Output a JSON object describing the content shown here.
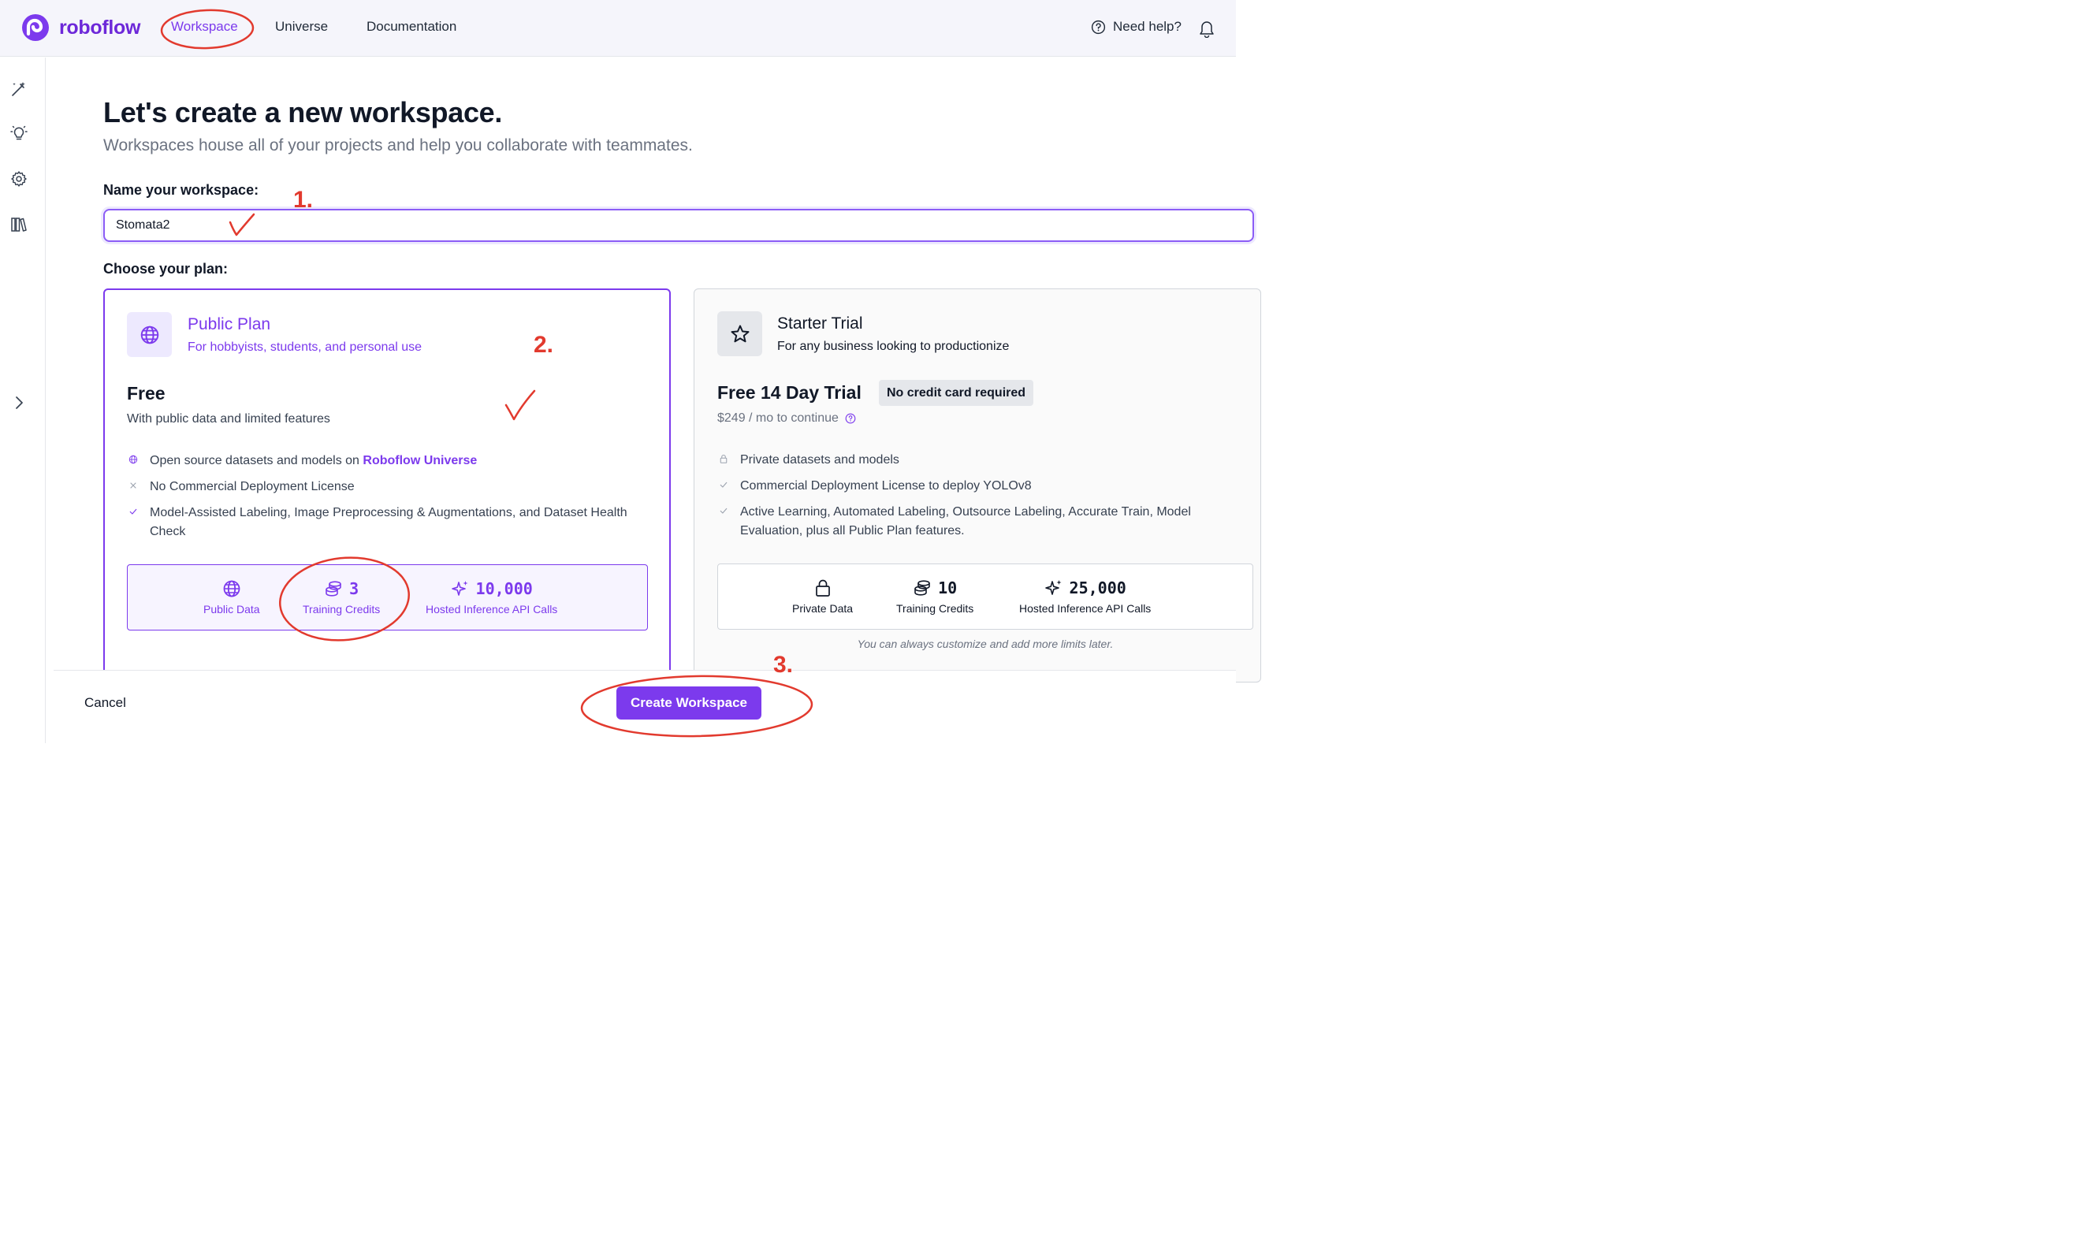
{
  "app": {
    "name": "roboflow"
  },
  "nav": {
    "workspace": "Workspace",
    "universe": "Universe",
    "documentation": "Documentation",
    "help": "Need help?"
  },
  "main": {
    "title": "Let's create a new workspace.",
    "subtitle": "Workspaces house all of your projects and help you collaborate with teammates.",
    "name_label": "Name your workspace:",
    "name_value": "Stomata2",
    "plan_label": "Choose your plan:"
  },
  "plans": {
    "public": {
      "title": "Public Plan",
      "desc": "For hobbyists, students, and personal use",
      "price": "Free",
      "price_sub": "With public data and limited features",
      "f1_prefix": "Open source datasets and models on ",
      "f1_link": "Roboflow Universe",
      "f2": "No Commercial Deployment License",
      "f3": "Model-Assisted Labeling, Image Preprocessing & Augmentations, and Dataset Health Check",
      "s1_label": "Public Data",
      "s2_num": "3",
      "s2_label": "Training Credits",
      "s3_num": "10,000",
      "s3_label": "Hosted Inference API Calls"
    },
    "starter": {
      "title": "Starter Trial",
      "desc": "For any business looking to productionize",
      "price": "Free 14 Day Trial",
      "badge": "No credit card required",
      "price_sub": "$249 / mo to continue",
      "f1": "Private datasets and models",
      "f2": "Commercial Deployment License to deploy YOLOv8",
      "f3": "Active Learning, Automated Labeling, Outsource Labeling, Accurate Train, Model Evaluation, plus all Public Plan features.",
      "s1_label": "Private Data",
      "s2_num": "10",
      "s2_label": "Training Credits",
      "s3_num": "25,000",
      "s3_label": "Hosted Inference API Calls",
      "note": "You can always customize and add more limits later."
    }
  },
  "footer": {
    "cancel": "Cancel",
    "create": "Create Workspace"
  },
  "annotations": {
    "step1": "1.",
    "step2": "2.",
    "step3": "3."
  },
  "colors": {
    "accent": "#7c3aed",
    "annotation": "#e23a2e"
  }
}
